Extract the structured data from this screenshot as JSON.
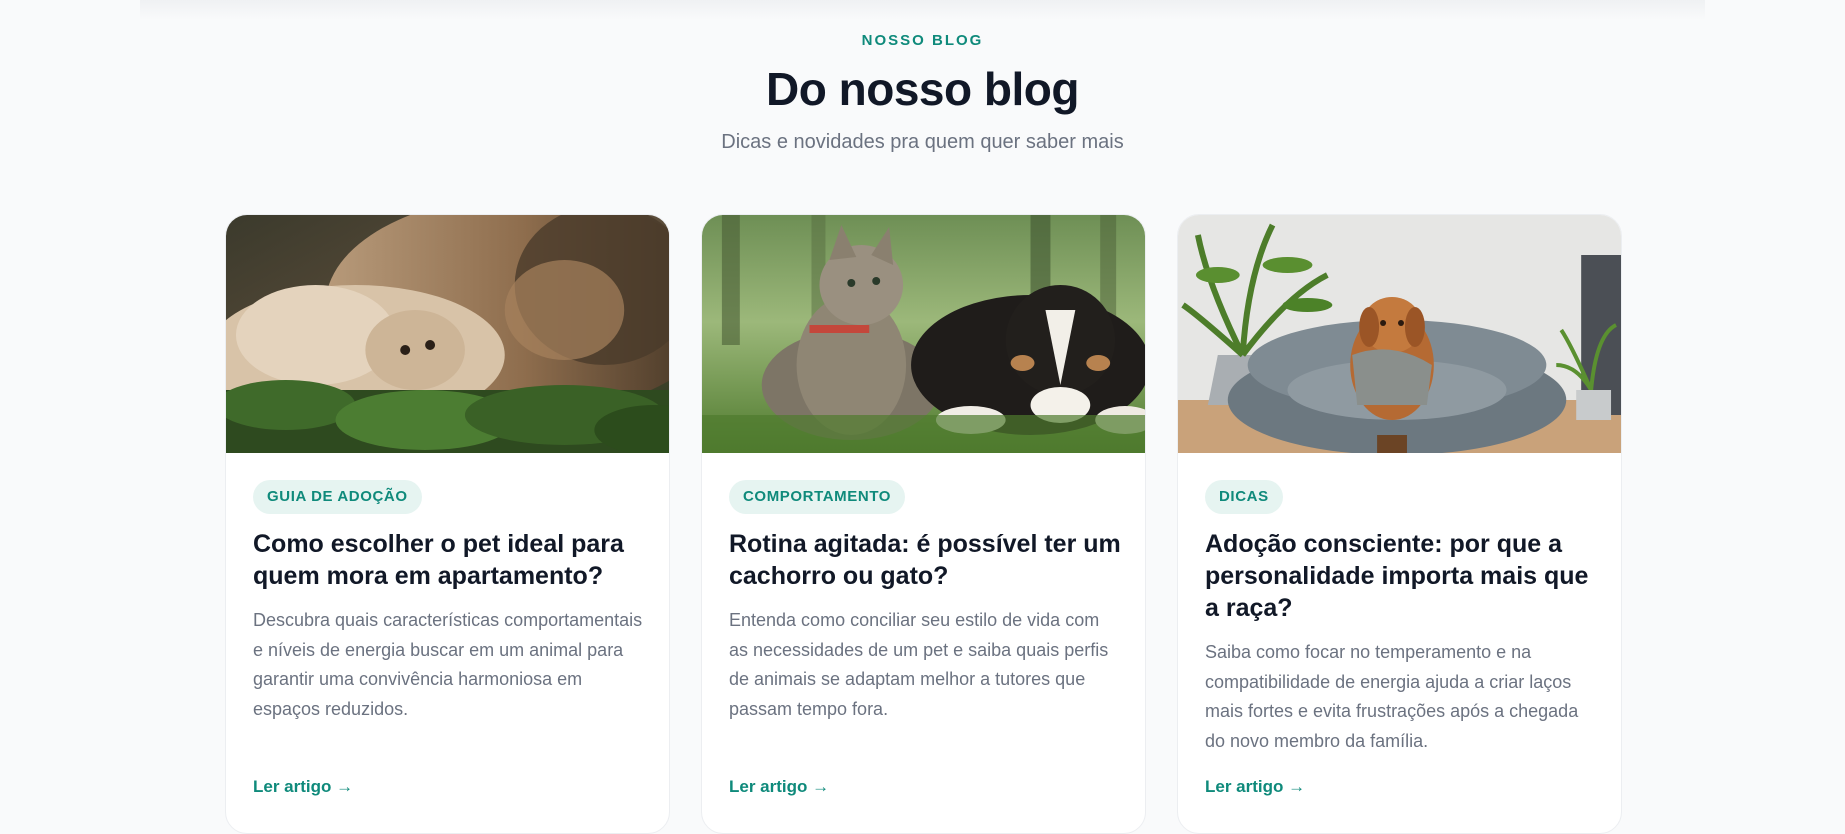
{
  "header": {
    "eyebrow": "NOSSO BLOG",
    "title": "Do nosso blog",
    "subtitle": "Dicas e novidades pra quem quer saber mais"
  },
  "posts": [
    {
      "image": "cat-and-dog-cuddling-in-grass-photo",
      "tag": "GUIA DE ADOÇÃO",
      "title": "Como escolher o pet ideal para quem mora em apartamento?",
      "excerpt": "Descubra quais características comportamentais e níveis de energia buscar em um animal para garantir uma convivência harmoniosa em espaços reduzidos.",
      "link_label": "Ler artigo →"
    },
    {
      "image": "cat-and-puppy-lying-on-lawn-photo",
      "tag": "COMPORTAMENTO",
      "title": "Rotina agitada: é possível ter um cachorro ou gato?",
      "excerpt": "Entenda como conciliar seu estilo de vida com as necessidades de um pet e saiba quais perfis de animais se adaptam melhor a tutores que passam tempo fora.",
      "link_label": "Ler artigo →"
    },
    {
      "image": "dog-in-grey-pet-bed-photo",
      "tag": "DICAS",
      "title": "Adoção consciente: por que a personalidade importa mais que a raça?",
      "excerpt": "Saiba como focar no temperamento e na compatibilidade de energia ajuda a criar laços mais fortes e evita frustrações após a chegada do novo membro da família.",
      "link_label": "Ler artigo →"
    }
  ],
  "colors": {
    "accent": "#0f8a7b",
    "tag_background": "#e6f4f1",
    "heading": "#111827",
    "muted_text": "#6b7280",
    "page_background": "#f9fafb"
  }
}
